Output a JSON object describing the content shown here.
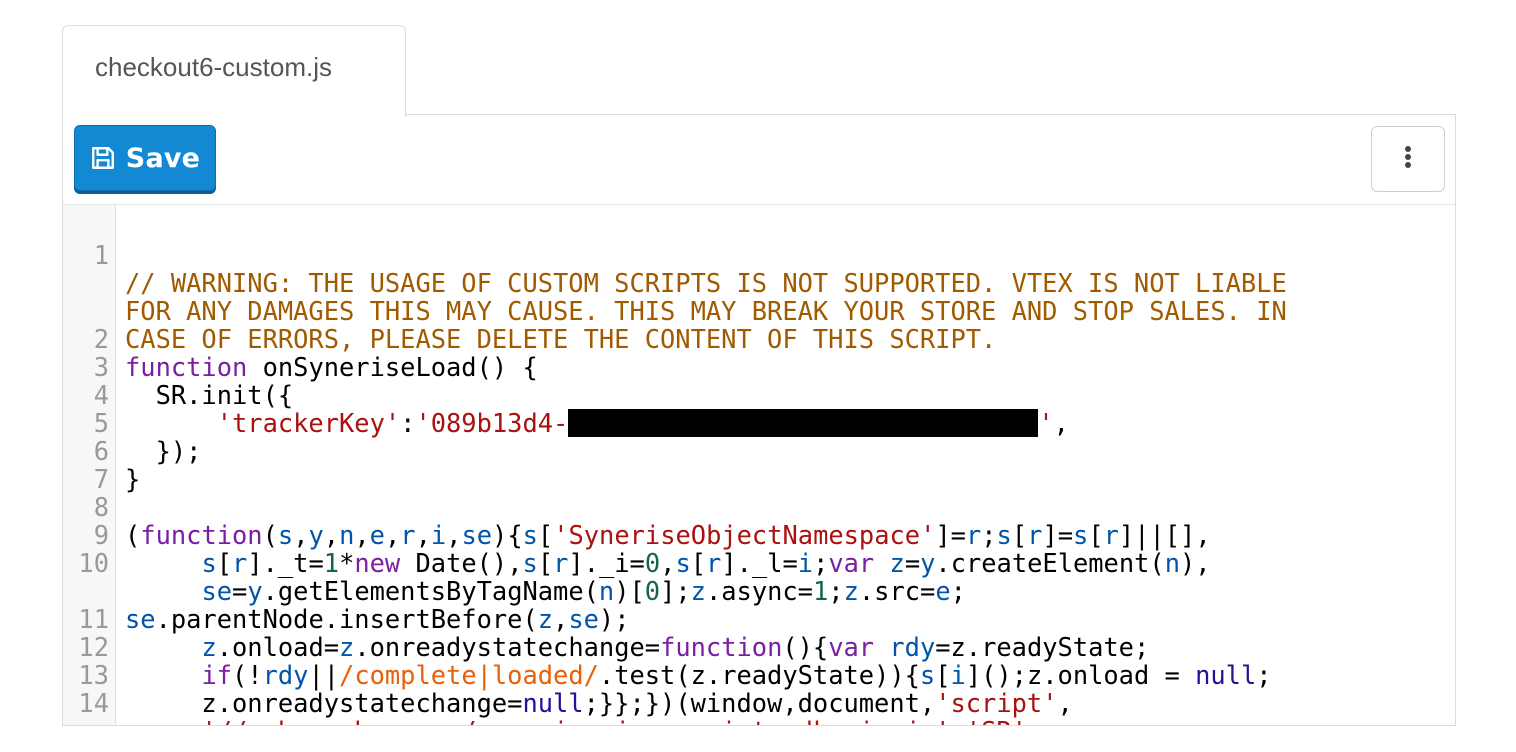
{
  "tab": {
    "label": "checkout6-custom.js"
  },
  "toolbar": {
    "save_label": "Save",
    "save_icon": "floppy-disk-icon",
    "more_icon": "vertical-ellipsis-icon"
  },
  "colors": {
    "save_button": "#1389d4",
    "comment": "#a05a00",
    "keyword": "#7a1fa2",
    "string": "#aa1111",
    "variable": "#0055aa",
    "number": "#116644",
    "regex": "#e8600a"
  },
  "editor": {
    "line_numbers": [
      "1",
      "2",
      "3",
      "4",
      "5",
      "6",
      "7",
      "8",
      "9",
      "10",
      "11",
      "12",
      "13",
      "14"
    ],
    "comment": [
      "// WARNING: THE USAGE OF CUSTOM SCRIPTS IS NOT SUPPORTED. VTEX IS NOT LIABLE",
      "FOR ANY DAMAGES THIS MAY CAUSE. THIS MAY BREAK YOUR STORE AND STOP SALES. IN",
      "CASE OF ERRORS, PLEASE DELETE THE CONTENT OF THIS SCRIPT."
    ],
    "tracker_key_visible": "'089b13d4-"
  }
}
